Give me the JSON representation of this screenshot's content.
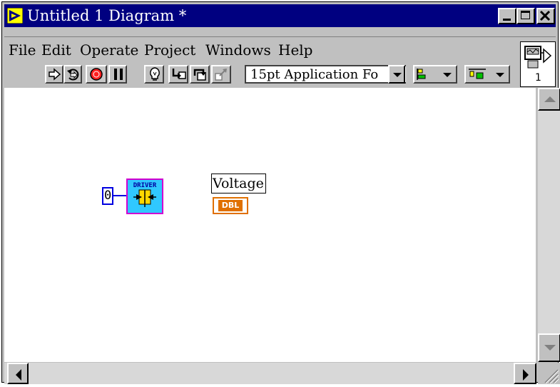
{
  "window": {
    "title": "Untitled 1 Diagram *",
    "minimize_icon": "minimize-icon",
    "maximize_icon": "maximize-icon",
    "close_icon": "close-icon"
  },
  "menu": {
    "items": [
      {
        "label": "File"
      },
      {
        "label": "Edit"
      },
      {
        "label": "Operate"
      },
      {
        "label": "Project"
      },
      {
        "label": "Windows"
      },
      {
        "label": "Help"
      }
    ]
  },
  "toolbar": {
    "buttons": [
      "run-icon",
      "run-continuously-icon",
      "abort-icon",
      "pause-icon",
      "highlight-execution-icon",
      "step-into-icon",
      "step-over-icon",
      "step-out-icon"
    ],
    "font_select": {
      "value": "15pt Application Fo"
    },
    "align_objects_icon": "align-objects-icon",
    "distribute_objects_icon": "distribute-objects-icon"
  },
  "connector_pane": {
    "label": "1"
  },
  "diagram": {
    "constant": {
      "value": "0"
    },
    "driver_node": {
      "label": "DRIVER"
    },
    "voltage_terminal": {
      "label": "Voltage",
      "type": "DBL"
    }
  },
  "colors": {
    "titlebar": "#000080",
    "wire": "#0000e0",
    "driver_fill": "#30c8ff",
    "driver_border": "#d000d0",
    "dbl": "#e07000"
  }
}
